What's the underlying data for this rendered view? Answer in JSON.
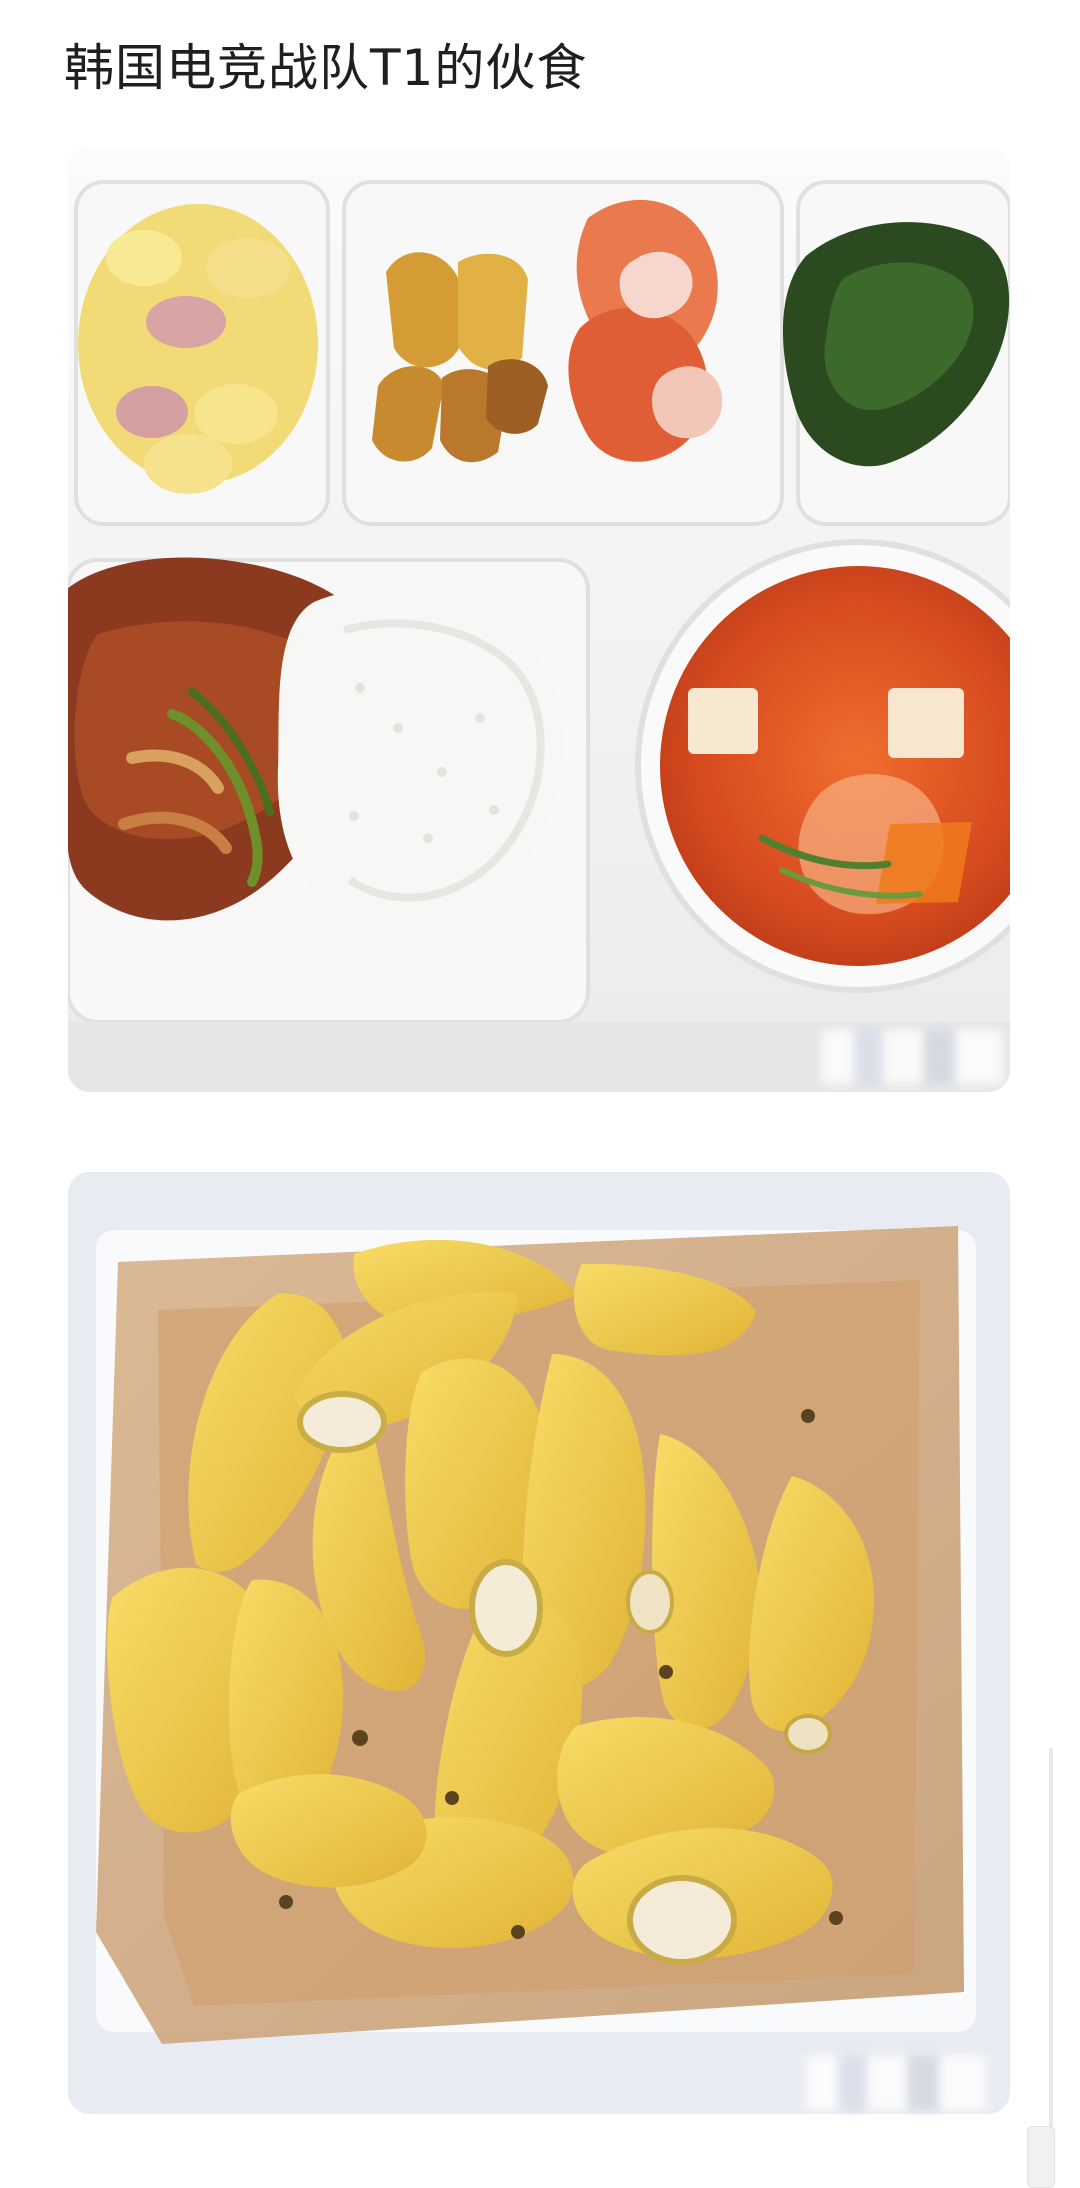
{
  "post": {
    "title": "韩国电竞战队T1的伙食"
  },
  "images": [
    {
      "subject": "tray-meal"
    },
    {
      "subject": "bananas"
    }
  ],
  "colors": {
    "background": "#ffffff",
    "title": "#1f1f1f",
    "tray": "#f6f6f6",
    "banana": "#f2c94c",
    "soup": "#d84e26",
    "kimchi": "#e7653b"
  },
  "icons": {
    "watermark": "blurred-watermark",
    "scroll": "scroll-handle"
  }
}
